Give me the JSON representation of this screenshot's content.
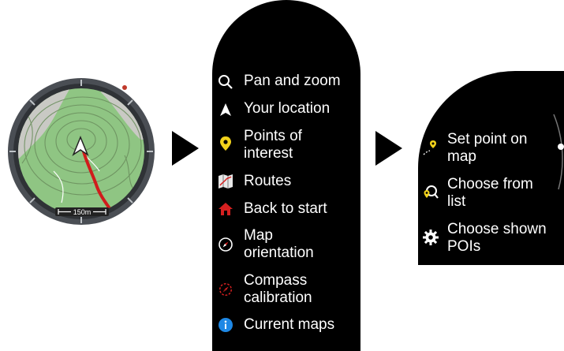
{
  "map_watch": {
    "scale_label": "150m",
    "icons": [
      "location-arrow-icon",
      "route-line"
    ]
  },
  "main_menu": {
    "items": [
      {
        "label": "Pan and zoom",
        "icon": "magnifier-icon"
      },
      {
        "label": "Your location",
        "icon": "location-arrow-icon"
      },
      {
        "label": "Points of\ninterest",
        "icon": "poi-pin-icon"
      },
      {
        "label": "Routes",
        "icon": "routes-map-icon"
      },
      {
        "label": "Back to start",
        "icon": "home-icon"
      },
      {
        "label": "Map\norientation",
        "icon": "compass-needle-icon"
      },
      {
        "label": "Compass\ncalibration",
        "icon": "calibration-icon"
      },
      {
        "label": "Current maps",
        "icon": "info-icon"
      }
    ]
  },
  "poi_menu": {
    "items": [
      {
        "label": "Set point on\nmap",
        "icon": "set-point-icon"
      },
      {
        "label": "Choose from\nlist",
        "icon": "choose-list-icon"
      },
      {
        "label": "Choose shown\nPOIs",
        "icon": "gear-icon"
      }
    ]
  },
  "colors": {
    "accent_yellow": "#f2d21b",
    "home_red": "#d62020",
    "info_blue": "#1e88e5",
    "route_red": "#d01c1c",
    "map_green": "#8fc583"
  }
}
